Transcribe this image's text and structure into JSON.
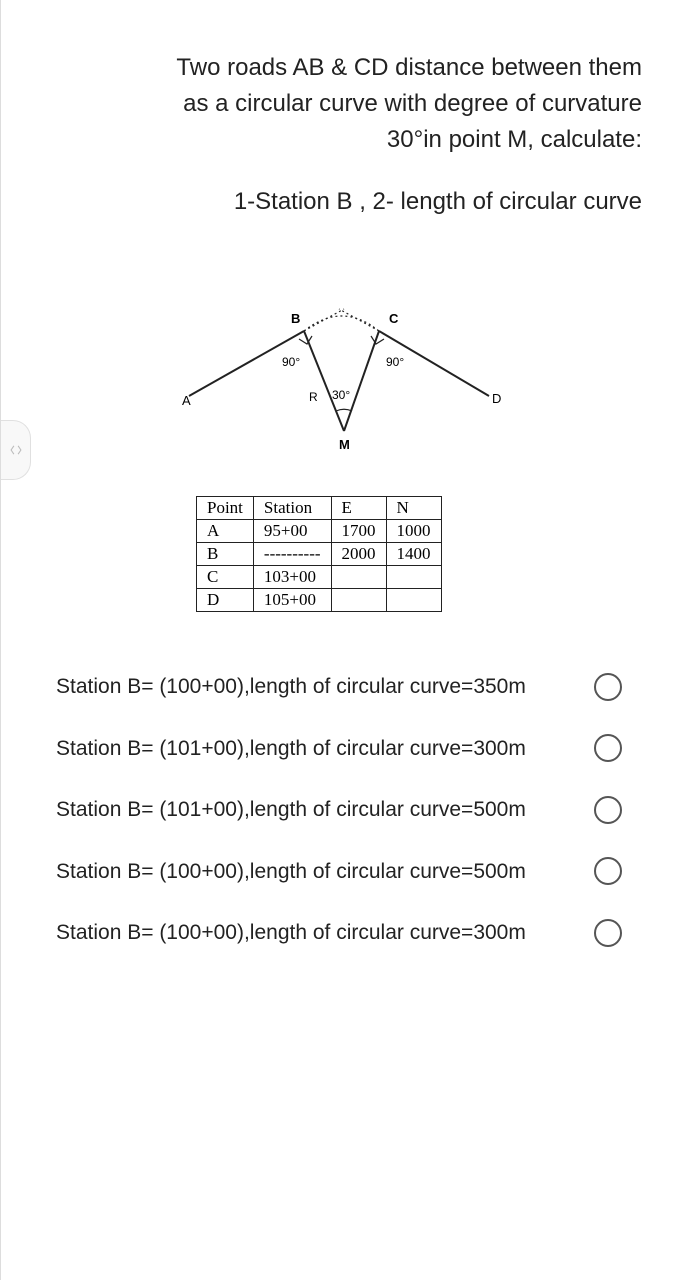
{
  "question": {
    "main_text": "Two roads AB & CD distance between them as a circular curve with degree of curvature 30°in point M, calculate:",
    "sub_text": "1-Station B   ,   2- length of circular curve"
  },
  "diagram": {
    "labels": {
      "A": "A",
      "B": "B",
      "C": "C",
      "D": "D",
      "R": "R",
      "M": "M",
      "angle_left": "90°",
      "angle_right": "90°",
      "angle_center": "30°"
    }
  },
  "table": {
    "headers": [
      "Point",
      "Station",
      "E",
      "N"
    ],
    "rows": [
      [
        "A",
        "95+00",
        "1700",
        "1000"
      ],
      [
        "B",
        "----------",
        "2000",
        "1400"
      ],
      [
        "C",
        "103+00",
        "",
        ""
      ],
      [
        "D",
        "105+00",
        "",
        ""
      ]
    ]
  },
  "options": [
    "Station B= (100+00),length of circular curve=350m",
    "Station B= (101+00),length of circular curve=300m",
    "Station B= (101+00),length of circular curve=500m",
    "Station B= (100+00),length of circular curve=500m",
    "Station B= (100+00),length of circular curve=300m"
  ]
}
